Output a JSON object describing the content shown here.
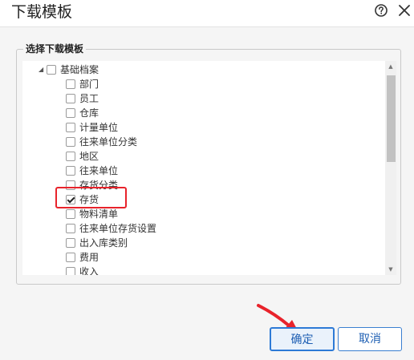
{
  "dialog": {
    "title": "下载模板",
    "help_icon": "help-circle-icon",
    "close_icon": "close-icon"
  },
  "group": {
    "legend": "选择下载模板"
  },
  "tree": {
    "root": {
      "label": "基础档案",
      "expanded": true,
      "checked": false
    },
    "items": [
      {
        "label": "部门",
        "checked": false
      },
      {
        "label": "员工",
        "checked": false
      },
      {
        "label": "仓库",
        "checked": false
      },
      {
        "label": "计量单位",
        "checked": false
      },
      {
        "label": "往来单位分类",
        "checked": false
      },
      {
        "label": "地区",
        "checked": false
      },
      {
        "label": "往来单位",
        "checked": false
      },
      {
        "label": "存货分类",
        "checked": false
      },
      {
        "label": "存货",
        "checked": true
      },
      {
        "label": "物料清单",
        "checked": false
      },
      {
        "label": "往来单位存货设置",
        "checked": false
      },
      {
        "label": "出入库类别",
        "checked": false
      },
      {
        "label": "费用",
        "checked": false
      },
      {
        "label": "收入",
        "checked": false
      }
    ]
  },
  "buttons": {
    "ok": "确定",
    "cancel": "取消"
  },
  "colors": {
    "highlight": "#e8232b",
    "accent": "#2d7ad6"
  }
}
